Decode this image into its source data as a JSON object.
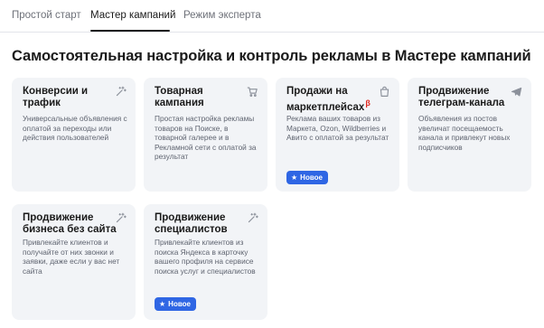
{
  "tabs": [
    {
      "label": "Простой старт"
    },
    {
      "label": "Мастер кампаний"
    },
    {
      "label": "Режим эксперта"
    }
  ],
  "page_title": "Самостоятельная настройка и контроль рекламы в Мастере кампаний",
  "cards": [
    {
      "title": "Конверсии и трафик",
      "description": "Универсальные объявления с оплатой за переходы или действия пользователей",
      "icon": "magic-wand-icon"
    },
    {
      "title": "Товарная кампания",
      "description": "Простая настройка рекламы товаров на Поиске, в товарной галерее и в Рекламной сети с оплатой за результат",
      "icon": "cart-icon"
    },
    {
      "title": "Продажи на маркетплейсах",
      "beta": "β",
      "description": "Реклама ваших товаров из Маркета, Ozon, Wildberries и Авито с оплатой за результат",
      "icon": "shopping-bag-icon",
      "badge": "Новое"
    },
    {
      "title": "Продвижение телеграм-канала",
      "description": "Объявления из постов увеличат посещаемость канала и привлекут новых подписчиков",
      "icon": "telegram-icon"
    },
    {
      "title": "Продвижение бизнеса без сайта",
      "description": "Привлекайте клиентов и получайте от них звонки и заявки, даже если у вас нет сайта",
      "icon": "magic-wand-icon"
    },
    {
      "title": "Продвижение специалистов",
      "description": "Привлекайте клиентов из поиска Яндекса в карточку вашего профиля на сервисе поиска услуг и специалистов",
      "icon": "magic-wand-icon",
      "badge": "Новое"
    }
  ],
  "colors": {
    "accent": "#2f66e4",
    "beta": "#e0281f",
    "card_bg": "#f2f4f7"
  }
}
